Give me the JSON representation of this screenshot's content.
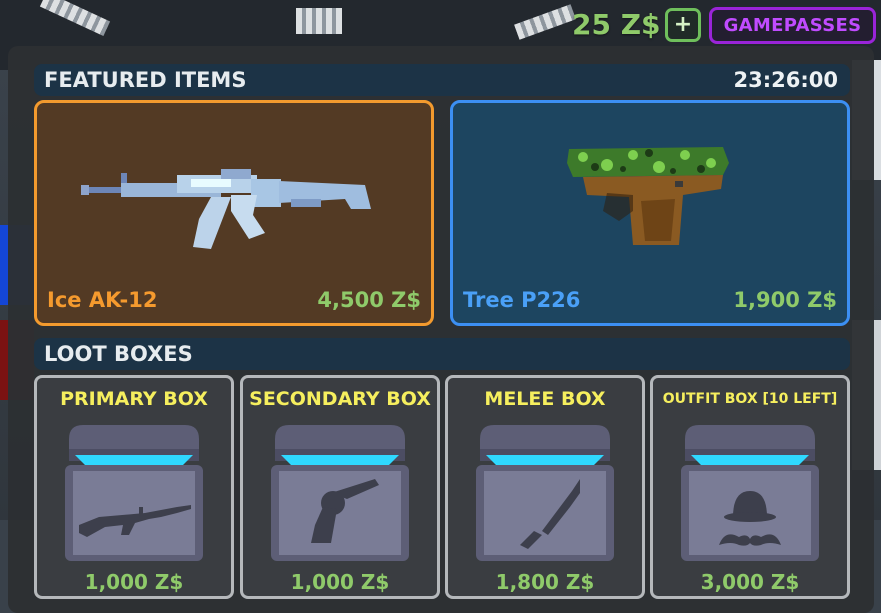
{
  "topbar": {
    "currency": "25 Z$",
    "plus_label": "+",
    "gamepasses_label": "GAMEPASSES"
  },
  "featured": {
    "header": "FEATURED ITEMS",
    "timer": "23:26:00",
    "items": [
      {
        "name": "Ice AK-12",
        "price": "4,500 Z$",
        "icon": "ak12-rifle-icon"
      },
      {
        "name": "Tree P226",
        "price": "1,900 Z$",
        "icon": "p226-pistol-icon"
      }
    ]
  },
  "loot": {
    "header": "LOOT BOXES",
    "boxes": [
      {
        "title": "PRIMARY BOX",
        "price": "1,000 Z$",
        "icon": "rifle-icon"
      },
      {
        "title": "SECONDARY BOX",
        "price": "1,000 Z$",
        "icon": "revolver-icon"
      },
      {
        "title": "MELEE BOX",
        "price": "1,800 Z$",
        "icon": "machete-icon"
      },
      {
        "title": "OUTFIT BOX [10 LEFT]",
        "price": "3,000 Z$",
        "icon": "bowler-hat-mustache-icon"
      }
    ]
  },
  "colors": {
    "currency_green": "#8fca6a",
    "gamepass_purple": "#9a24d8",
    "ak_orange": "#f39a2e",
    "p226_blue": "#3c8ff3",
    "box_title_yellow": "#f6ef5e",
    "chest_glow": "#2fd8ff"
  }
}
